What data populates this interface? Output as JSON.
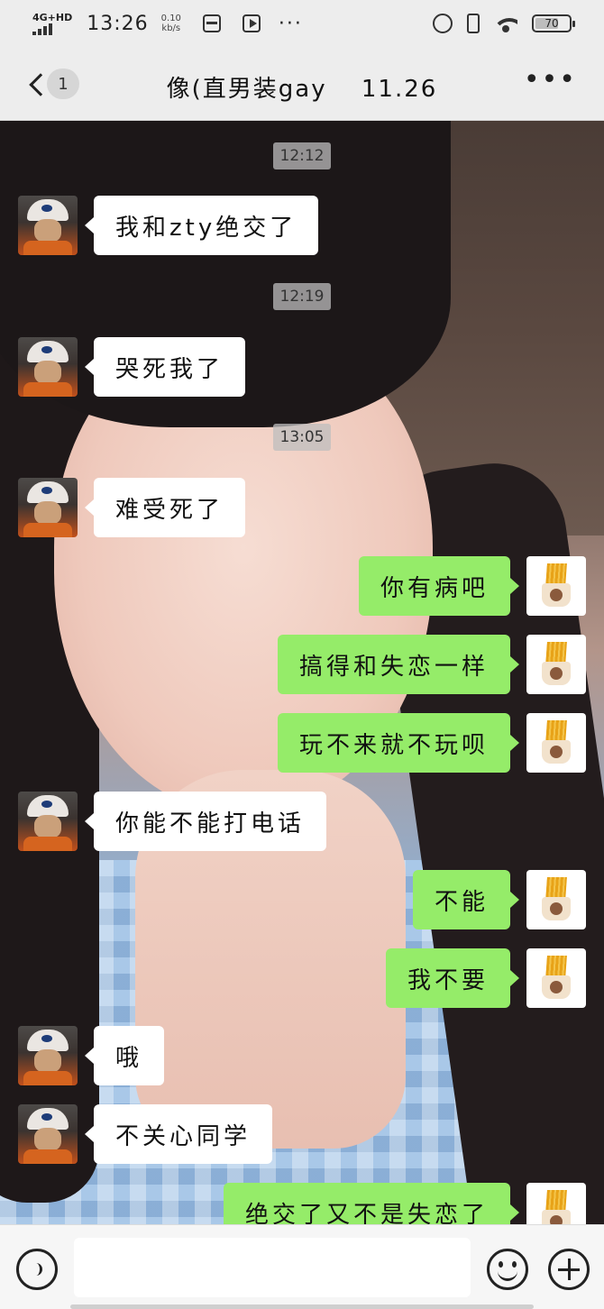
{
  "status_bar": {
    "network": "4G+HD",
    "time": "13:26",
    "speed_value": "0.10",
    "speed_unit": "kb/s",
    "battery": "70",
    "battery_level": 0.7
  },
  "header": {
    "back_icon": "chevron-left-icon",
    "unread_count": "1",
    "title": "像(直男装gay　 11.26",
    "more_icon": "more-dots-icon"
  },
  "chat": {
    "timestamps": [
      "12:12",
      "12:19",
      "13:05"
    ],
    "messages": [
      {
        "side": "in",
        "text": "我和zty绝交了"
      },
      {
        "side": "in",
        "text": "哭死我了"
      },
      {
        "side": "in",
        "text": "难受死了"
      },
      {
        "side": "out",
        "text": "你有病吧"
      },
      {
        "side": "out",
        "text": "搞得和失恋一样"
      },
      {
        "side": "out",
        "text": "玩不来就不玩呗"
      },
      {
        "side": "in",
        "text": "你能不能打电话"
      },
      {
        "side": "out",
        "text": "不能"
      },
      {
        "side": "out",
        "text": "我不要"
      },
      {
        "side": "in",
        "text": "哦"
      },
      {
        "side": "in",
        "text": "不关心同学"
      },
      {
        "side": "out",
        "text": "绝交了又不是失恋了"
      }
    ]
  },
  "input_bar": {
    "voice_icon": "voice-icon",
    "input_value": "",
    "emoji_icon": "emoji-icon",
    "plus_icon": "plus-icon"
  },
  "colors": {
    "outgoing_bubble": "#95ec69",
    "incoming_bubble": "#ffffff",
    "header_bg": "#ededed"
  }
}
